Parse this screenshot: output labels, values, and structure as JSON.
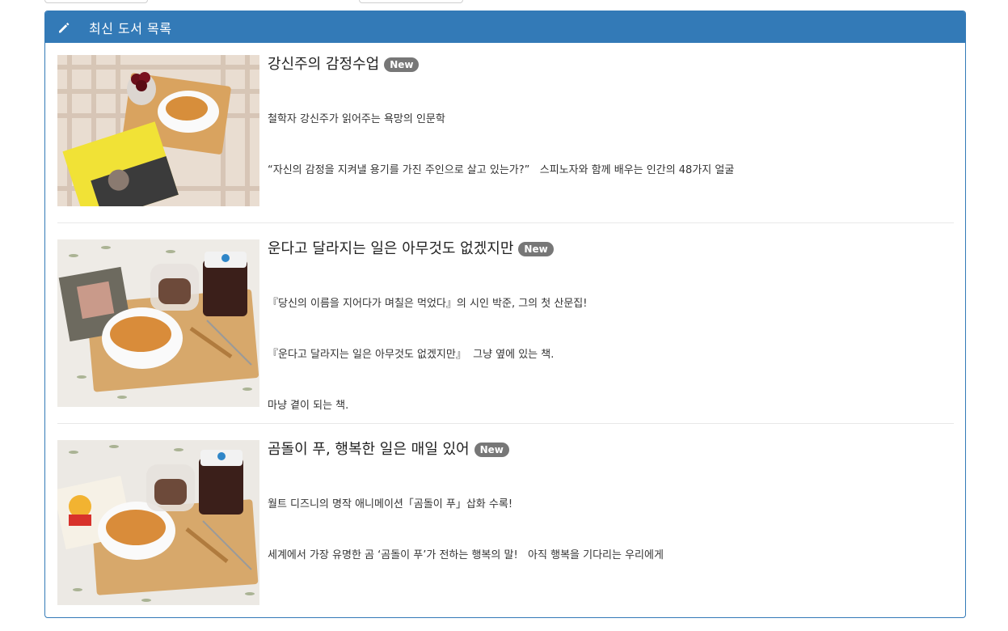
{
  "panel": {
    "title": "최신 도서 목록",
    "icon": "pencil-icon",
    "color": "#337ab7"
  },
  "books": [
    {
      "title": "강신주의 감정수업",
      "badge": "New",
      "lines": [
        "철학자 강신주가 읽어주는 욕망의 인문학",
        "“자신의 감정을 지켜낼 용기를 가진 주인으로 살고 있는가?”   스피노자와 함께 배우는 인간의 48가지 얼굴"
      ]
    },
    {
      "title": "운다고 달라지는 일은 아무것도 없겠지만",
      "badge": "New",
      "lines": [
        "『당신의 이름을 지어다가 며칠은 먹었다』의 시인 박준, 그의 첫 산문집!",
        "『운다고 달라지는 일은 아무것도 없겠지만』  그냥 옆에 있는 책.",
        "마냥 곁이 되는 책."
      ]
    },
    {
      "title": "곰돌이 푸, 행복한 일은 매일 있어",
      "badge": "New",
      "lines": [
        "월트 디즈니의 명작 애니메이션「곰돌이 푸」삽화 수록!",
        "세계에서 가장 유명한 곰 ‘곰돌이 푸’가 전하는 행복의 말!   아직 행복을 기다리는 우리에게"
      ]
    }
  ]
}
